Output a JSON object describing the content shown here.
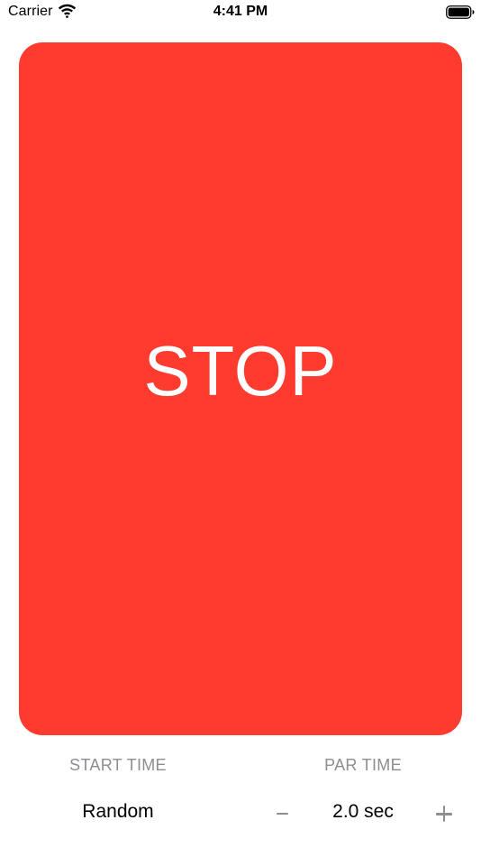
{
  "status_bar": {
    "carrier": "Carrier",
    "time": "4:41 PM",
    "icons": [
      "wifi-icon",
      "battery-icon"
    ]
  },
  "signal": {
    "text": "STOP",
    "color": "#ff3b30"
  },
  "controls": {
    "start_time_label": "START TIME",
    "start_time_value": "Random",
    "par_time_label": "PAR TIME",
    "par_time_value": "2.0 sec",
    "decrement_icon": "minus-icon",
    "increment_icon": "plus-icon"
  },
  "colors": {
    "secondary_text": "#8e8e93"
  }
}
